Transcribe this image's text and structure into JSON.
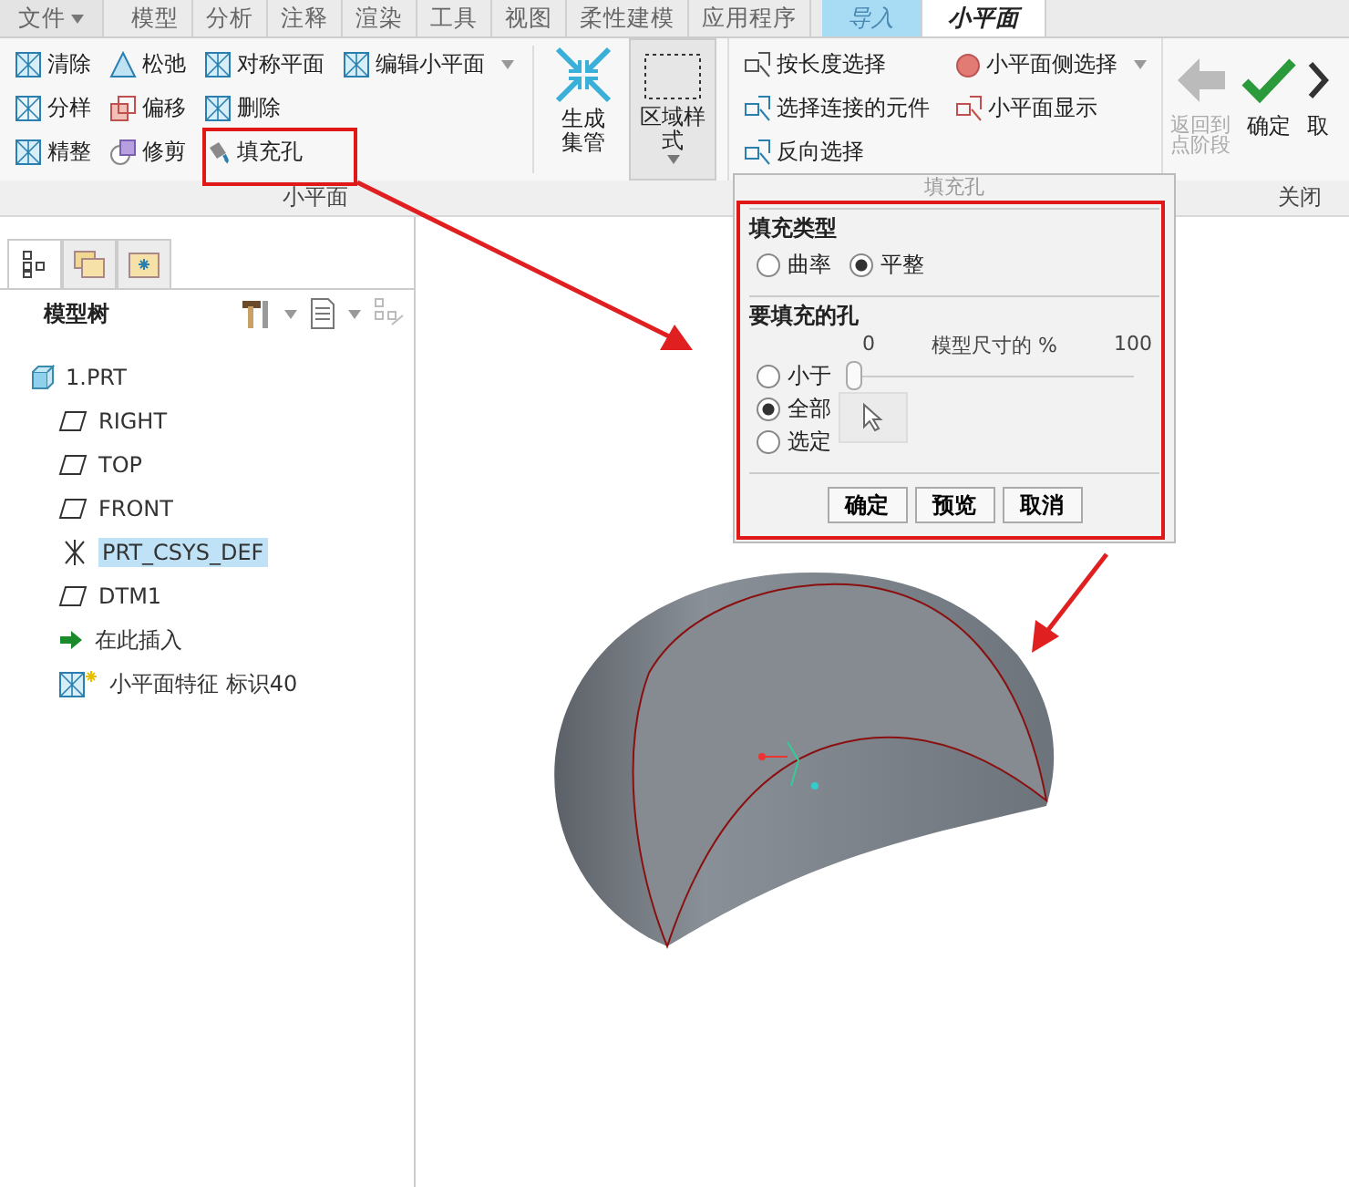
{
  "ribbon_tabs": [
    {
      "label": "文件",
      "kind": "file",
      "selected": false
    },
    {
      "label": "模型",
      "kind": "normal",
      "selected": false
    },
    {
      "label": "分析",
      "kind": "normal",
      "selected": false
    },
    {
      "label": "注释",
      "kind": "normal",
      "selected": false
    },
    {
      "label": "渲染",
      "kind": "normal",
      "selected": false
    },
    {
      "label": "工具",
      "kind": "normal",
      "selected": false
    },
    {
      "label": "视图",
      "kind": "normal",
      "selected": false
    },
    {
      "label": "柔性建模",
      "kind": "normal",
      "selected": false
    },
    {
      "label": "应用程序",
      "kind": "normal",
      "selected": false
    },
    {
      "label": "导入",
      "kind": "contextual",
      "selected": false
    },
    {
      "label": "小平面",
      "kind": "contextual",
      "selected": true
    }
  ],
  "facet_group": {
    "label": "小平面",
    "columns": [
      [
        {
          "label": "清除",
          "kind": "grid",
          "dropdown": false
        },
        {
          "label": "分样",
          "kind": "dots",
          "dropdown": false
        },
        {
          "label": "精整",
          "kind": "grid",
          "dropdown": false
        }
      ],
      [
        {
          "label": "松弛",
          "kind": "triangle",
          "dropdown": false
        },
        {
          "label": "偏移",
          "kind": "offset",
          "dropdown": false
        },
        {
          "label": "修剪",
          "kind": "trim",
          "dropdown": false
        }
      ],
      [
        {
          "label": "对称平面",
          "kind": "mirror",
          "dropdown": false
        },
        {
          "label": "删除",
          "kind": "delete",
          "dropdown": false
        },
        {
          "label": "填充孔",
          "kind": "bucket",
          "dropdown": false
        }
      ],
      [
        {
          "label": "编辑小平面",
          "kind": "edit",
          "dropdown": true
        }
      ]
    ],
    "large_buttons": [
      {
        "label": "生成集管",
        "kind": "arrows",
        "dropdown": false
      },
      {
        "label": "区域样式",
        "kind": "region",
        "dropdown": true
      }
    ]
  },
  "selection_commands": [
    [
      {
        "label": "按长度选择",
        "kind": "length",
        "dropdown": false
      },
      {
        "label": "选择连接的元件",
        "kind": "connected",
        "dropdown": false
      },
      {
        "label": "反向选择",
        "kind": "invert",
        "dropdown": false
      }
    ],
    [
      {
        "label": "小平面侧选择",
        "kind": "dot",
        "dropdown": true
      },
      {
        "label": "小平面显示",
        "kind": "display",
        "dropdown": false
      }
    ]
  ],
  "close_group": {
    "label": "关闭",
    "buttons": [
      {
        "label": "返回到点阶段",
        "kind": "back",
        "disabled": true
      },
      {
        "label": "确定",
        "kind": "ok",
        "disabled": false
      },
      {
        "label": "取",
        "kind": "cancel",
        "disabled": false
      }
    ]
  },
  "panel_tabs": [
    {
      "kind": "tree",
      "selected": true
    },
    {
      "kind": "folders",
      "selected": false
    },
    {
      "kind": "favorites",
      "selected": false
    }
  ],
  "model_tree": {
    "title": "模型树",
    "items": [
      {
        "label": "1.PRT",
        "kind": "part",
        "selected": false,
        "children": [
          {
            "label": "RIGHT",
            "kind": "plane",
            "selected": false
          },
          {
            "label": "TOP",
            "kind": "plane",
            "selected": false
          },
          {
            "label": "FRONT",
            "kind": "plane",
            "selected": false
          },
          {
            "label": "PRT_CSYS_DEF",
            "kind": "csys",
            "selected": true
          },
          {
            "label": "DTM1",
            "kind": "plane",
            "selected": false
          },
          {
            "label": "在此插入",
            "kind": "insert",
            "selected": false
          },
          {
            "label": "小平面特征 标识40",
            "kind": "facet",
            "selected": false
          }
        ]
      }
    ]
  },
  "dialog": {
    "title": "填充孔",
    "fill_type": {
      "label": "填充类型",
      "options": [
        {
          "label": "曲率",
          "selected": false
        },
        {
          "label": "平整",
          "selected": true
        }
      ]
    },
    "holes": {
      "label": "要填充的孔",
      "scale_min": "0",
      "scale_label": "模型尺寸的 %",
      "scale_max": "100",
      "level": 0,
      "options": [
        {
          "label": "小于",
          "selected": false
        },
        {
          "label": "全部",
          "selected": true
        },
        {
          "label": "选定",
          "selected": false
        }
      ]
    },
    "buttons": [
      "确定",
      "预览",
      "取消"
    ]
  }
}
